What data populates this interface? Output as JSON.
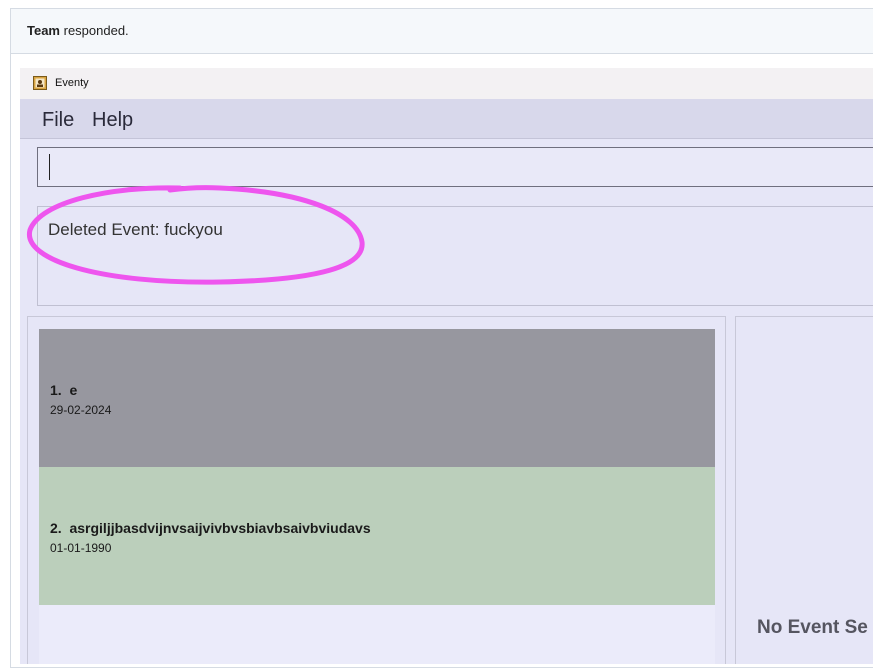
{
  "notice": {
    "actor": "Team",
    "text": " responded."
  },
  "window": {
    "title": "Eventy",
    "icon": "person-card-icon"
  },
  "menu": {
    "file": "File",
    "help": "Help"
  },
  "command": {
    "value": ""
  },
  "result": {
    "text": "Deleted Event: fuckyou",
    "annotation_color": "#ee55ee"
  },
  "events": [
    {
      "index": "1.",
      "name": "e",
      "date": "29-02-2024",
      "color": "#97979f"
    },
    {
      "index": "2.",
      "name": "asrgiljjbasdvijnvsaijvivbvsbiavbsaivbviudavs",
      "date": "01-01-1990",
      "color": "#bbcfbb"
    }
  ],
  "detail": {
    "empty_text": "No Event Se"
  }
}
